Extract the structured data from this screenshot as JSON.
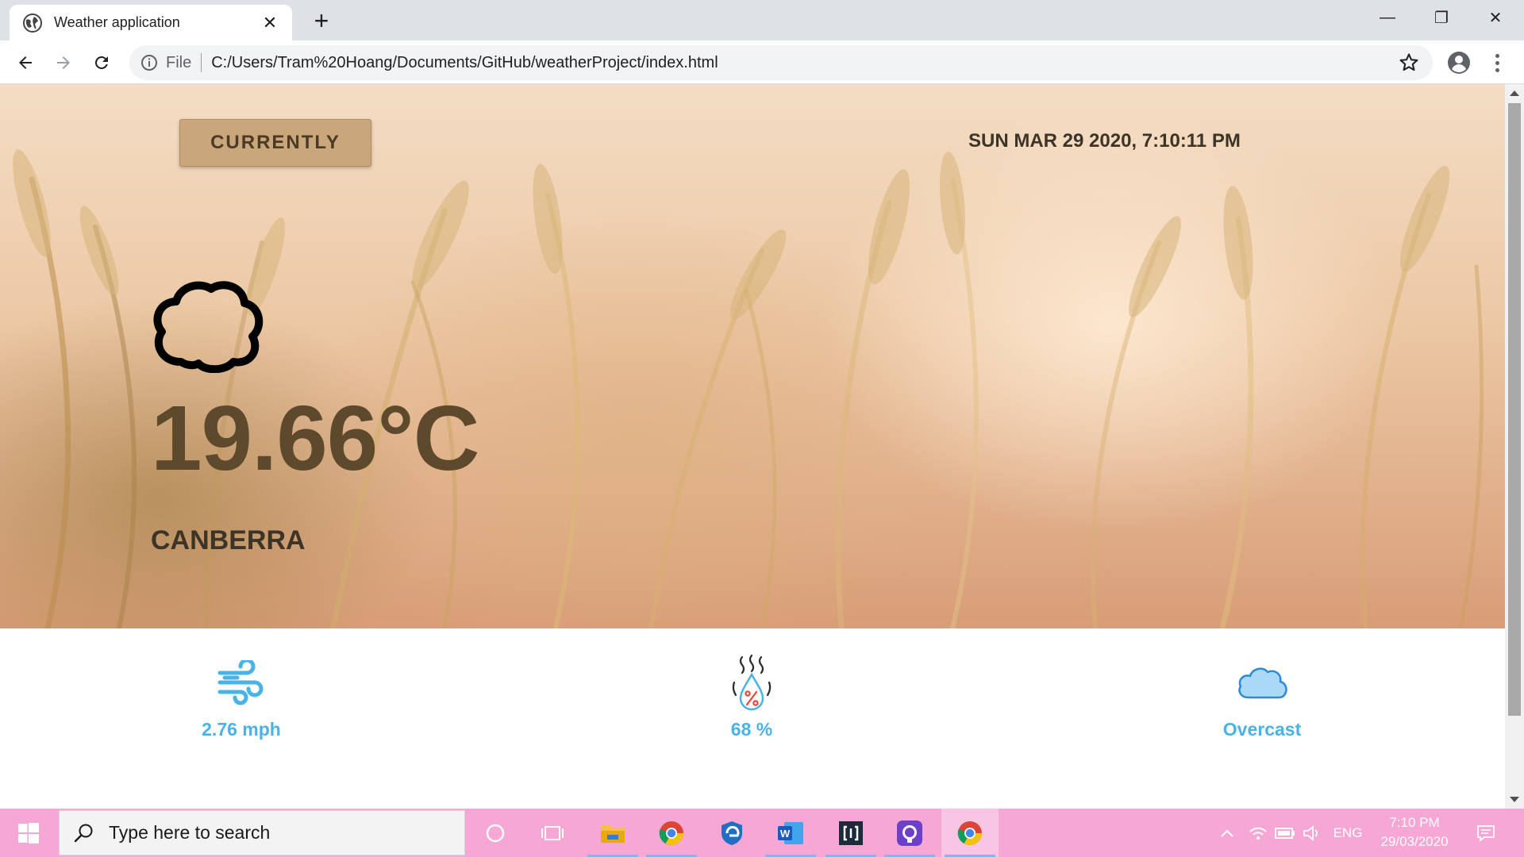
{
  "browser": {
    "tab_title": "Weather application",
    "tab_close": "✕",
    "new_tab": "+",
    "window_minimize": "—",
    "window_restore": "❐",
    "window_close": "✕",
    "omnibox_scheme": "File",
    "url": "C:/Users/Tram%20Hoang/Documents/GitHub/weatherProject/index.html"
  },
  "page": {
    "currently_button": "CURRENTLY",
    "datetime": "SUN MAR 29 2020, 7:10:11 PM",
    "weather_icon": "cloud-icon",
    "temperature": "19.66°C",
    "city": "CANBERRA",
    "stats": {
      "wind": {
        "icon": "wind-icon",
        "value": "2.76 mph"
      },
      "humidity": {
        "icon": "humidity-icon",
        "value": "68 %"
      },
      "summary": {
        "icon": "cloud-icon",
        "value": "Overcast"
      }
    },
    "accent_color": "#4ab3e6",
    "temperature_color": "#5d4a2d"
  },
  "taskbar": {
    "search_placeholder": "Type here to search",
    "apps": [
      "cortana-icon",
      "task-view-icon",
      "file-explorer-icon",
      "chrome-icon",
      "edge-icon",
      "word-icon",
      "brackets-icon",
      "github-desktop-icon",
      "chrome-icon"
    ],
    "language": "ENG",
    "time": "7:10 PM",
    "date": "29/03/2020",
    "background_color": "#f6a7d6"
  }
}
